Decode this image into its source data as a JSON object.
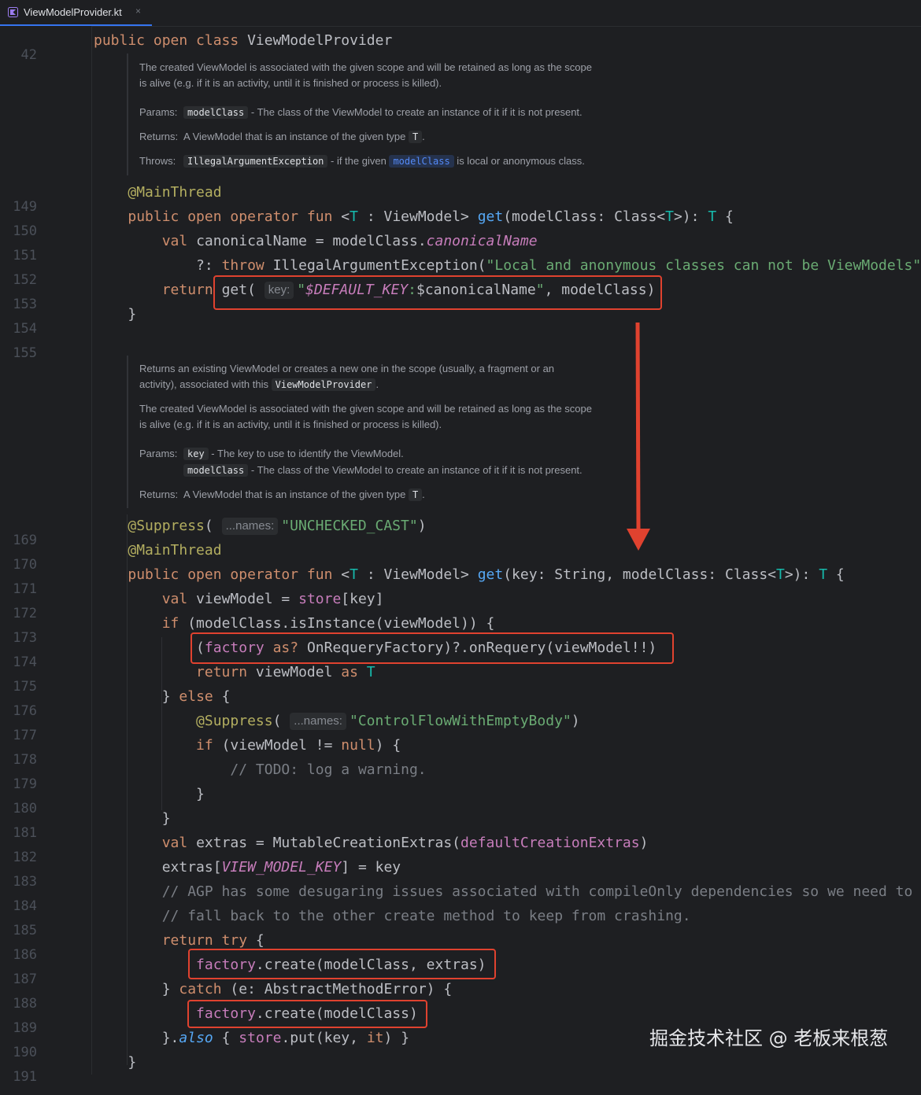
{
  "tab": {
    "label": "ViewModelProvider.kt",
    "close": "×",
    "icon": "kotlin-file-icon"
  },
  "line_numbers": [
    "42",
    "149",
    "150",
    "151",
    "152",
    "153",
    "154",
    "155",
    "169",
    "170",
    "171",
    "172",
    "173",
    "174",
    "175",
    "176",
    "177",
    "178",
    "179",
    "180",
    "181",
    "182",
    "183",
    "184",
    "185",
    "186",
    "187",
    "188",
    "189",
    "190",
    "191"
  ],
  "doc1": {
    "desc_1": "The created ViewModel is associated with the given scope and will be retained as long as the scope",
    "desc_2": "is alive (e.g. if it is an activity, until it is finished or process is killed).",
    "params_label": "Params:",
    "param_modelClass": "modelClass",
    "param_modelClass_desc": " - The class of the ViewModel to create an instance of it if it is not present.",
    "returns_label": "Returns:",
    "returns_text": "A ViewModel that is an instance of the given type ",
    "returns_type": "T",
    "returns_tail": ".",
    "throws_label": "Throws:",
    "throws_type": "IllegalArgumentException",
    "throws_mid": " - if the given ",
    "throws_ref": "modelClass",
    "throws_tail": " is local or anonymous class."
  },
  "doc2": {
    "desc_1": "Returns an existing ViewModel or creates a new one in the scope (usually, a fragment or an",
    "desc_2_pre": "activity), associated with this ",
    "desc_2_ref": "ViewModelProvider",
    "desc_2_tail": ".",
    "desc_3": "The created ViewModel is associated with the given scope and will be retained as long as the scope",
    "desc_4": "is alive (e.g. if it is an activity, until it is finished or process is killed).",
    "params_label": "Params:",
    "param_key": "key",
    "param_key_desc": " - The key to use to identify the ViewModel.",
    "param_modelClass": "modelClass",
    "param_modelClass_desc": " - The class of the ViewModel to create an instance of it if it is not present.",
    "returns_label": "Returns:",
    "returns_text": "A ViewModel that is an instance of the given type ",
    "returns_type": "T",
    "returns_tail": "."
  },
  "hints": {
    "key": "key:",
    "names": "...names:"
  },
  "code": {
    "l42_kw": "public open class ",
    "l42_name": "ViewModelProvider",
    "l149_ann": "@MainThread",
    "l150_kw": "public open operator fun ",
    "l150_a": "<",
    "l150_t": "T",
    "l150_b": " : ViewModel> ",
    "l150_fn": "get",
    "l150_c": "(modelClass: Class<",
    "l150_t2": "T",
    "l150_d": ">): ",
    "l150_t3": "T",
    "l150_e": " {",
    "l151_kw": "val ",
    "l151_a": "canonicalName = modelClass.",
    "l151_prop": "canonicalName",
    "l152_a": "?: ",
    "l152_kw": "throw ",
    "l152_b": "IllegalArgumentException(",
    "l152_str": "\"Local and anonymous classes can not be ViewModels\"",
    "l152_c": ")",
    "l153_kw": "return ",
    "l153_a": "get( ",
    "l153_str1": "\"",
    "l153_prop": "$DEFAULT_KEY",
    "l153_str2": ":",
    "l153_b": "$canonicalName",
    "l153_str3": "\"",
    "l153_c": ", modelClass)",
    "l154": "}",
    "l169_ann": "@Suppress",
    "l169_a": "( ",
    "l169_str": "\"UNCHECKED_CAST\"",
    "l169_b": ")",
    "l170_ann": "@MainThread",
    "l171_kw": "public open operator fun ",
    "l171_a": "<",
    "l171_t": "T",
    "l171_b": " : ViewModel> ",
    "l171_fn": "get",
    "l171_c": "(key: String, modelClass: Class<",
    "l171_t2": "T",
    "l171_d": ">): ",
    "l171_t3": "T",
    "l171_e": " {",
    "l172_kw": "val ",
    "l172_a": "viewModel = ",
    "l172_prop": "store",
    "l172_b": "[key]",
    "l173_kw": "if ",
    "l173_a": "(modelClass.isInstance(viewModel)) {",
    "l174_a": "(",
    "l174_prop": "factory",
    "l174_kw": " as? ",
    "l174_b": "OnRequeryFactory)?.onRequery(viewModel!!)",
    "l175_kw": "return ",
    "l175_a": "viewModel ",
    "l175_kw2": "as ",
    "l175_t": "T",
    "l176_a": "} ",
    "l176_kw": "else",
    "l176_b": " {",
    "l177_ann": "@Suppress",
    "l177_a": "( ",
    "l177_str": "\"ControlFlowWithEmptyBody\"",
    "l177_b": ")",
    "l178_kw": "if ",
    "l178_a": "(viewModel != ",
    "l178_kw2": "null",
    "l178_b": ") {",
    "l179_cmt": "// TODO: log a warning.",
    "l180": "}",
    "l181": "}",
    "l182_kw": "val ",
    "l182_a": "extras = MutableCreationExtras(",
    "l182_prop": "defaultCreationExtras",
    "l182_b": ")",
    "l183_a": "extras[",
    "l183_prop": "VIEW_MODEL_KEY",
    "l183_b": "] = key",
    "l184_cmt": "// AGP has some desugaring issues associated with compileOnly dependencies so we need to",
    "l185_cmt": "// fall back to the other create method to keep from crashing.",
    "l186_kw": "return try",
    "l186_a": " {",
    "l187_prop": "factory",
    "l187_a": ".create(modelClass, extras)",
    "l188_a": "} ",
    "l188_kw": "catch",
    "l188_b": " (e: AbstractMethodError) {",
    "l189_prop": "factory",
    "l189_a": ".create(modelClass)",
    "l190_a": "}.",
    "l190_fn": "also",
    "l190_b": " { ",
    "l190_prop": "store",
    "l190_c": ".put(key, ",
    "l190_it": "it",
    "l190_d": ") }",
    "l191": "}"
  },
  "watermark": "掘金技术社区 @ 老板来根葱",
  "colors": {
    "highlight_box": "#e0422f",
    "arrow": "#e0422f",
    "background": "#1e1f22"
  }
}
